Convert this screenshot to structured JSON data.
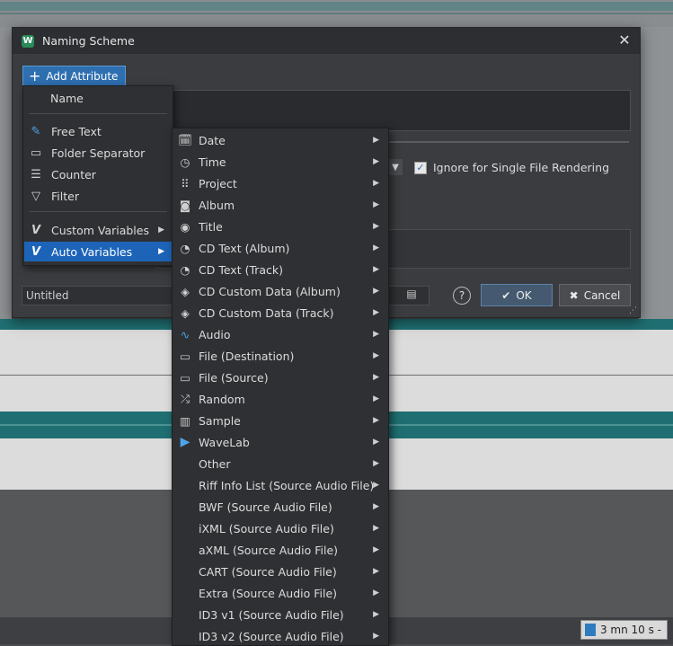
{
  "dialog": {
    "title": "Naming Scheme",
    "add_attribute_label": "Add Attribute",
    "ignore_checkbox_label": "Ignore for Single File Rendering",
    "preset_value": "Untitled",
    "ok_label": "OK",
    "cancel_label": "Cancel"
  },
  "status": {
    "time": "3 mn 10 s -"
  },
  "left_menu": {
    "header": "Name",
    "items": [
      {
        "label": "Free Text",
        "icon": "pencil-icon"
      },
      {
        "label": "Folder Separator",
        "icon": "folder-icon"
      },
      {
        "label": "Counter",
        "icon": "counter-icon"
      },
      {
        "label": "Filter",
        "icon": "filter-icon"
      },
      {
        "label": "Custom Variables",
        "icon": "custom-variables-icon"
      },
      {
        "label": "Auto Variables",
        "icon": "auto-variables-icon"
      }
    ]
  },
  "submenu": {
    "items": [
      {
        "label": "Date",
        "icon": "calendar-clock-icon"
      },
      {
        "label": "Time",
        "icon": "clock-icon"
      },
      {
        "label": "Project",
        "icon": "grid-icon"
      },
      {
        "label": "Album",
        "icon": "album-icon"
      },
      {
        "label": "Title",
        "icon": "title-disc-icon"
      },
      {
        "label": "CD Text (Album)",
        "icon": "cd-text-icon"
      },
      {
        "label": "CD Text (Track)",
        "icon": "cd-text-icon"
      },
      {
        "label": "CD Custom Data (Album)",
        "icon": "tag-icon"
      },
      {
        "label": "CD Custom Data (Track)",
        "icon": "tag-icon"
      },
      {
        "label": "Audio",
        "icon": "waveform-icon"
      },
      {
        "label": "File (Destination)",
        "icon": "folder-icon"
      },
      {
        "label": "File (Source)",
        "icon": "folder-icon"
      },
      {
        "label": "Random",
        "icon": "shuffle-icon"
      },
      {
        "label": "Sample",
        "icon": "piano-icon"
      },
      {
        "label": "WaveLab",
        "icon": "play-icon"
      },
      {
        "label": "Other",
        "icon": ""
      },
      {
        "label": "Riff Info List (Source Audio File)",
        "icon": ""
      },
      {
        "label": "BWF (Source Audio File)",
        "icon": ""
      },
      {
        "label": "iXML (Source Audio File)",
        "icon": ""
      },
      {
        "label": "aXML (Source Audio File)",
        "icon": ""
      },
      {
        "label": "CART (Source Audio File)",
        "icon": ""
      },
      {
        "label": "Extra (Source Audio File)",
        "icon": ""
      },
      {
        "label": "ID3 v1 (Source Audio File)",
        "icon": ""
      },
      {
        "label": "ID3 v2 (Source Audio File)",
        "icon": ""
      }
    ]
  },
  "colors": {
    "accent": "#1d64b8",
    "wave": "#1f7a7a",
    "wave_green": "#3a7a2a"
  }
}
